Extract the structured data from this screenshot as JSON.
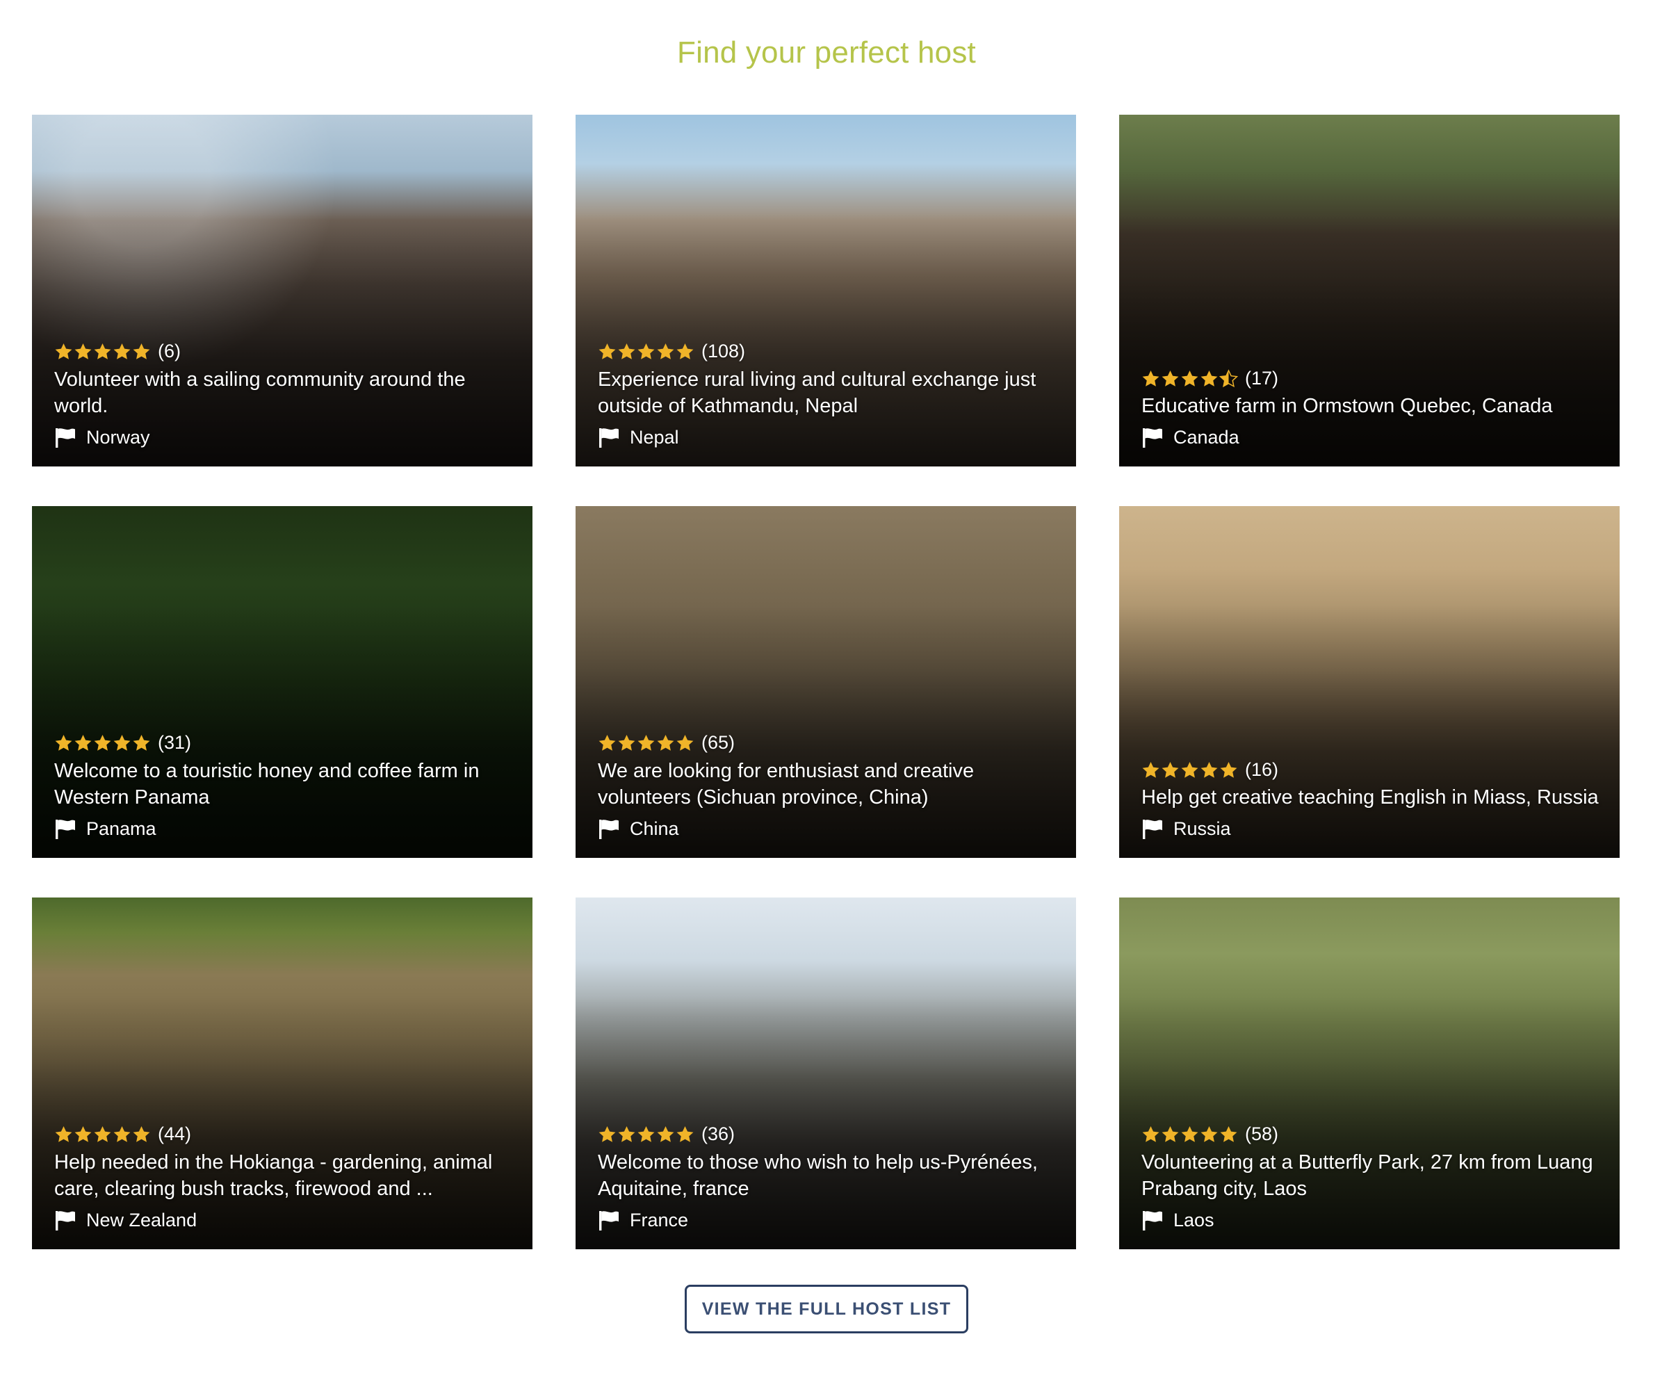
{
  "header": {
    "title": "Find your perfect host",
    "title_color": "#b5c44a"
  },
  "theme": {
    "star_color": "#f0b429",
    "button_border_color": "#2b3e61",
    "button_text_color": "#3b4f73",
    "card_text_color": "#ffffff"
  },
  "cards": [
    {
      "rating": 5,
      "review_count": "(6)",
      "heading": "Volunteer with a sailing community around the world.",
      "country": "Norway",
      "flag_icon": "flag-icon",
      "photo": "ph-sail"
    },
    {
      "rating": 5,
      "review_count": "(108)",
      "heading": "Experience rural living and cultural exchange just outside of Kathmandu, Nepal",
      "country": "Nepal",
      "flag_icon": "flag-icon",
      "photo": "ph-nepal"
    },
    {
      "rating": 4.5,
      "review_count": "(17)",
      "heading": "Educative farm in Ormstown Quebec, Canada",
      "country": "Canada",
      "flag_icon": "flag-icon",
      "photo": "ph-horses"
    },
    {
      "rating": 5,
      "review_count": "(31)",
      "heading": "Welcome to a touristic honey and coffee farm in Western Panama",
      "country": "Panama",
      "flag_icon": "flag-icon",
      "photo": "ph-garden"
    },
    {
      "rating": 5,
      "review_count": "(65)",
      "heading": "We are looking for enthusiast and creative volunteers (Sichuan province, China)",
      "country": "China",
      "flag_icon": "flag-icon",
      "photo": "ph-china"
    },
    {
      "rating": 5,
      "review_count": "(16)",
      "heading": "Help get creative teaching English in Miass, Russia",
      "country": "Russia",
      "flag_icon": "flag-icon",
      "photo": "ph-russia"
    },
    {
      "rating": 5,
      "review_count": "(44)",
      "heading": "Help needed in the Hokianga - gardening, animal care, clearing bush tracks, firewood and ...",
      "country": "New Zealand",
      "flag_icon": "flag-icon",
      "photo": "ph-calf"
    },
    {
      "rating": 5,
      "review_count": "(36)",
      "heading": "Welcome to those who wish to help us-Pyrénées, Aquitaine, france",
      "country": "France",
      "flag_icon": "flag-icon",
      "photo": "ph-france"
    },
    {
      "rating": 5,
      "review_count": "(58)",
      "heading": "Volunteering at a Butterfly Park, 27 km from Luang Prabang city, Laos",
      "country": "Laos",
      "flag_icon": "flag-icon",
      "photo": "ph-butterfly"
    }
  ],
  "footer": {
    "button_label": "VIEW THE FULL HOST LIST"
  }
}
